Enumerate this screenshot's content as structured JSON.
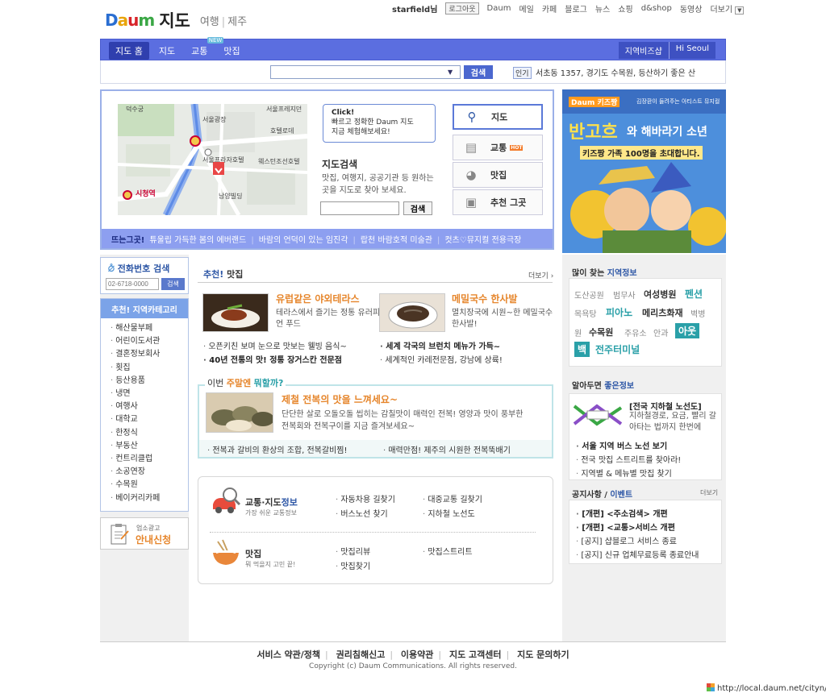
{
  "header": {
    "logo_text": "Daum",
    "service_name": "지도",
    "sub_links": [
      "여행",
      "제주"
    ],
    "user": "starfield님",
    "logout": "로그아웃",
    "top_links": [
      "Daum",
      "메일",
      "카페",
      "블로그",
      "뉴스",
      "쇼핑",
      "d&shop",
      "동영상",
      "더보기"
    ]
  },
  "nav": {
    "tabs": [
      {
        "label": "지도 홈",
        "active": true
      },
      {
        "label": "지도"
      },
      {
        "label": "교통",
        "badge": "NEW"
      },
      {
        "label": "맛집"
      }
    ],
    "right": [
      "지역비즈샵",
      "Hi Seoul"
    ]
  },
  "search": {
    "value": "",
    "button": "검색",
    "hot_label": "인기",
    "hot_text": "서초동 1357, 경기도 수목원, 등산하기 좋은 산"
  },
  "mapbox": {
    "callout": {
      "title": "Click!",
      "line1": "빠르고 정확한 Daum 지도",
      "line2": "지금 체험해보세요!"
    },
    "title": "지도검색",
    "desc": "맛집, 여행지, 공공기관 등 원하는 곳을 지도로 찾아 보세요.",
    "search_button": "검색",
    "map_labels": [
      "덕수궁",
      "서울프레지던",
      "서울광장",
      "호텔로데",
      "서울프라자호텔",
      "웨스턴조선호텔",
      "남양빌딩",
      "시청역"
    ],
    "menu": [
      {
        "label": "지도",
        "icon": "magnifier-icon",
        "active": true
      },
      {
        "label": "교통",
        "icon": "bus-icon",
        "badge": "HOT"
      },
      {
        "label": "맛집",
        "icon": "bowl-icon"
      },
      {
        "label": "추천 그곳",
        "icon": "camera-icon"
      }
    ],
    "ticker_label": "뜨는그곳!",
    "ticker_items": [
      "튜울립 가득한 봄의 에버랜드",
      "바람의 언덕이 있는 임진각",
      "랍천 바람호적 미술관",
      "컷츠♡뮤지컬 전용극장"
    ]
  },
  "banner": {
    "brand": "Daum 키즈짱",
    "top_text": "김장환이 들려주는 아티스트 뮤지컬",
    "title_a": "반고흐",
    "title_b": "와 해바라기 소년",
    "subtitle": "키즈짱 가족 100명을 초대합니다."
  },
  "left": {
    "phone_title": "전화번호 검색",
    "phone_placeholder": "02-6718-0000",
    "phone_button": "검색",
    "cat_title": "추천! 지역카테고리",
    "categories": [
      "해산물부페",
      "어린이도서관",
      "결혼정보회사",
      "횟집",
      "등산용품",
      "냉면",
      "여행사",
      "대학교",
      "한정식",
      "부동산",
      "컨트리클럽",
      "소공연장",
      "수목원",
      "베이커리카페"
    ],
    "ad_small": "업소광고",
    "ad_big": "안내신청"
  },
  "food": {
    "title_em": "추천!",
    "title": " 맛집",
    "more": "더보기",
    "items": [
      {
        "name": "유럽같은 야외테라스",
        "desc": "테라스에서 즐기는 정통 유러피언 푸드"
      },
      {
        "name": "메밀국수 한사발",
        "desc": "멸치장국에 시원~한 메밀국수 한사발!"
      }
    ],
    "bullets": [
      {
        "text": "오픈키친 보며 눈으로 맛보는 웰빙 음식~",
        "bold": false
      },
      {
        "text": "세계 각국의 브런치 메뉴가 가득~",
        "bold": true
      },
      {
        "text": "40년 전통의 맛! 정통 장거스칸 전문점",
        "bold": true
      },
      {
        "text": "세계적인 카레전문점, 강남에 상륙!",
        "bold": false
      }
    ],
    "weekend": {
      "title_a": "이번 ",
      "title_em": "주말엔",
      "title_b": " ",
      "title_em2": "뭐할까?",
      "name": "제철 전복의 맛을 느껴세요~",
      "desc": "단단한 살로 오돌오돌 씹히는 감칠맛이 매력인 전복! 영양과 맛이 풍부한 전복회와 전복구이를 지금 즐겨보세요~",
      "links": [
        "전복과 갈비의 환상의 조합, 전복갈비찜!",
        "매력만점! 제주의 시원한 전복뚝배기"
      ]
    }
  },
  "linkbox": {
    "traffic": {
      "title_a": "교통·지도",
      "title_em": "정보",
      "sub": "가장 쉬운 교통정보",
      "links": [
        "자동차용 길찾기",
        "대중교통 길찾기",
        "버스노선 찾기",
        "지하철 노선도"
      ]
    },
    "food": {
      "title": "맛집",
      "sub": "뭐 먹을지 고민 끝!",
      "links": [
        "맛집리뷰",
        "맛집스트리트",
        "맛집찾기"
      ]
    }
  },
  "right": {
    "region_title_a": "많이 찾는 ",
    "region_title_em": "지역정보",
    "keywords": [
      "도산공원",
      "범무사",
      "여성병원",
      "펜션",
      "목욕탕",
      "피아노",
      "메리츠화재",
      "벽병",
      "원",
      "수목원",
      "주유소",
      "안과",
      "아웃",
      "백",
      "전주터미널"
    ],
    "info_title_a": "알아두면 ",
    "info_title_em": "좋은정보",
    "subway_title": "[전국 지하철 노선도]",
    "subway_desc": "지하철경로, 요금, 빨리 갈아타는 법까지 한번에",
    "info_links": [
      {
        "text": "서울 지역 버스 노선 보기",
        "bold": true
      },
      {
        "text": "전국 맛집 스트리트를 찾아라!",
        "bold": false
      },
      {
        "text": "지역별 & 메뉴별 맛집 찾기",
        "bold": false
      }
    ],
    "notice_title_a": "공지사항 / ",
    "notice_title_em": "이벤트",
    "notice_more": "더보기",
    "notices": [
      {
        "text": "[개편] <주소검색> 개편",
        "bold": true
      },
      {
        "text": "[개편] <교통>서비스 개편",
        "bold": true
      },
      {
        "text": "[공지] 샵블로그 서비스 종료",
        "bold": false
      },
      {
        "text": "[공지] 신규 업체무료등록 종료안내",
        "bold": false
      }
    ]
  },
  "footer": {
    "links": [
      "서비스 약관/정책",
      "권리침해신고",
      "이용약관",
      "지도 고객센터",
      "지도 문의하기"
    ],
    "copyright": "Copyright (c) Daum Communications. All rights reserved."
  },
  "statusbar": {
    "url": "http://local.daum.net/cityn/"
  },
  "colors": {
    "nav": "#5b6ee0",
    "accent_orange": "#e6862c",
    "accent_teal": "#2aa0a8",
    "link_blue": "#2e57a6"
  }
}
